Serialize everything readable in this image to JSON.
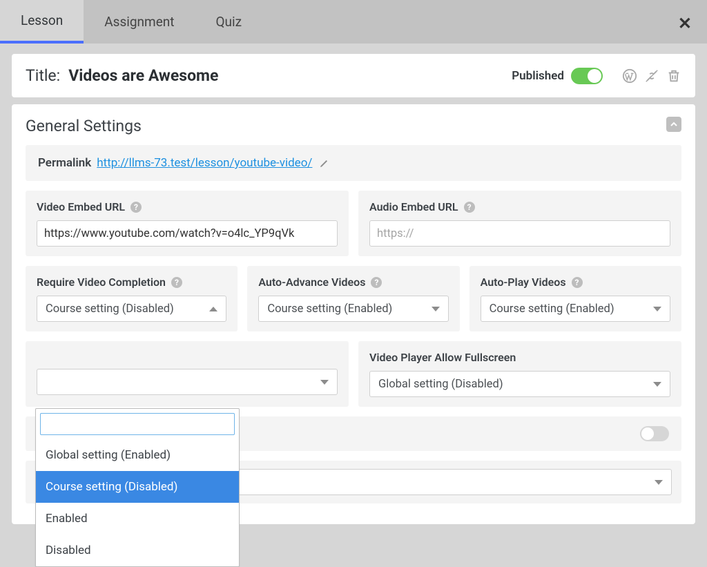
{
  "tabs": {
    "lesson": "Lesson",
    "assignment": "Assignment",
    "quiz": "Quiz"
  },
  "title_bar": {
    "label": "Title:",
    "value": "Videos are Awesome",
    "published_label": "Published"
  },
  "panel": {
    "heading": "General Settings",
    "permalink_label": "Permalink",
    "permalink_url": "http://llms-73.test/lesson/youtube-video/"
  },
  "fields": {
    "video_embed_label": "Video Embed URL",
    "video_embed_value": "https://www.youtube.com/watch?v=o4lc_YP9qVk",
    "audio_embed_label": "Audio Embed URL",
    "audio_embed_placeholder": "https://",
    "require_completion_label": "Require Video Completion",
    "require_completion_value": "Course setting (Disabled)",
    "auto_advance_label": "Auto-Advance Videos",
    "auto_advance_value": "Course setting (Enabled)",
    "auto_play_label": "Auto-Play Videos",
    "auto_play_value": "Course setting (Enabled)",
    "fullscreen_label": "Video Player Allow Fullscreen",
    "fullscreen_value": "Global setting (Disabled)"
  },
  "dropdown_options": [
    "Global setting (Enabled)",
    "Course setting (Disabled)",
    "Enabled",
    "Disabled"
  ]
}
